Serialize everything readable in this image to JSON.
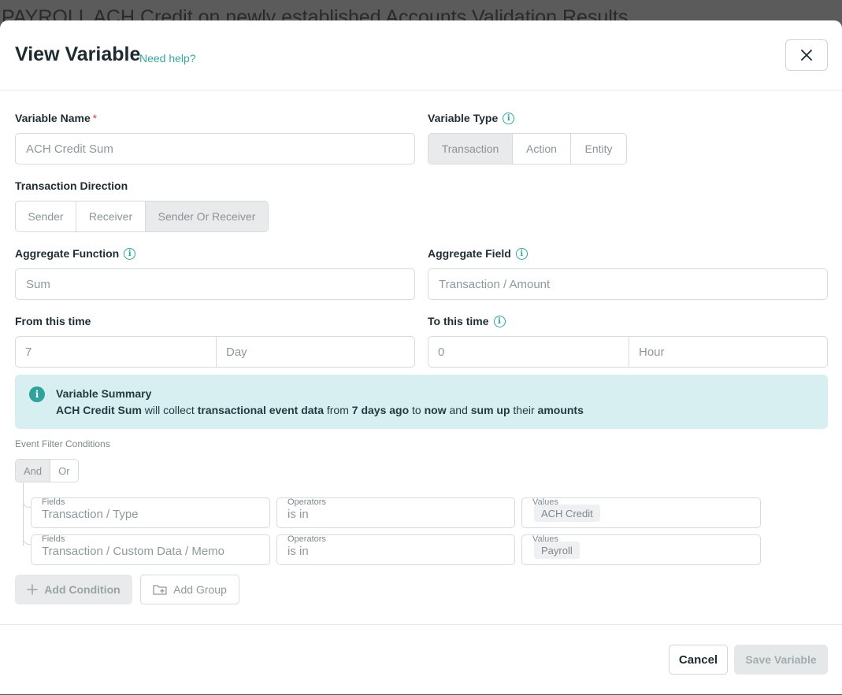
{
  "background": {
    "title": "PAYROLL ACH Credit on newly established Accounts Validation Results"
  },
  "modal": {
    "title": "View Variable",
    "help_link": "Need help?"
  },
  "variable_name": {
    "label": "Variable Name",
    "required_mark": "*",
    "value": "ACH Credit Sum"
  },
  "variable_type": {
    "label": "Variable Type",
    "options": [
      "Transaction",
      "Action",
      "Entity"
    ],
    "selected": "Transaction"
  },
  "transaction_direction": {
    "label": "Transaction Direction",
    "options": [
      "Sender",
      "Receiver",
      "Sender Or Receiver"
    ],
    "selected": "Sender Or Receiver"
  },
  "aggregate_function": {
    "label": "Aggregate Function",
    "value": "Sum"
  },
  "aggregate_field": {
    "label": "Aggregate Field",
    "value": "Transaction / Amount"
  },
  "from_time": {
    "label": "From this time",
    "amount": "7",
    "unit": "Day"
  },
  "to_time": {
    "label": "To this time",
    "amount": "0",
    "unit": "Hour"
  },
  "summary": {
    "title": "Variable Summary",
    "name": "ACH Credit Sum",
    "t1": " will collect ",
    "b1": "transactional event data",
    "t2": " from ",
    "b2": "7 days ago",
    "t3": " to ",
    "b3": "now",
    "t4": " and ",
    "b4": "sum up",
    "t5": " their ",
    "b5": "amounts"
  },
  "event_filter": {
    "label": "Event Filter Conditions",
    "logic_options": [
      "And",
      "Or"
    ],
    "selected": "And",
    "conditions": [
      {
        "field_caption": "Fields",
        "field": "Transaction / Type",
        "operator_caption": "Operators",
        "operator": "is in",
        "values_caption": "Values",
        "value": "ACH Credit"
      },
      {
        "field_caption": "Fields",
        "field": "Transaction / Custom Data / Memo",
        "operator_caption": "Operators",
        "operator": "is in",
        "values_caption": "Values",
        "value": "Payroll"
      }
    ]
  },
  "buttons": {
    "add_condition": "Add Condition",
    "add_group": "Add Group",
    "cancel": "Cancel",
    "save": "Save Variable"
  },
  "icons": {
    "close": "close-icon",
    "info": "info-icon",
    "plus": "plus-icon",
    "folder_plus": "folder-plus-icon"
  },
  "colors": {
    "accent": "#2fa39b",
    "summary_bg": "#d7eff0",
    "required": "#e0454a"
  }
}
